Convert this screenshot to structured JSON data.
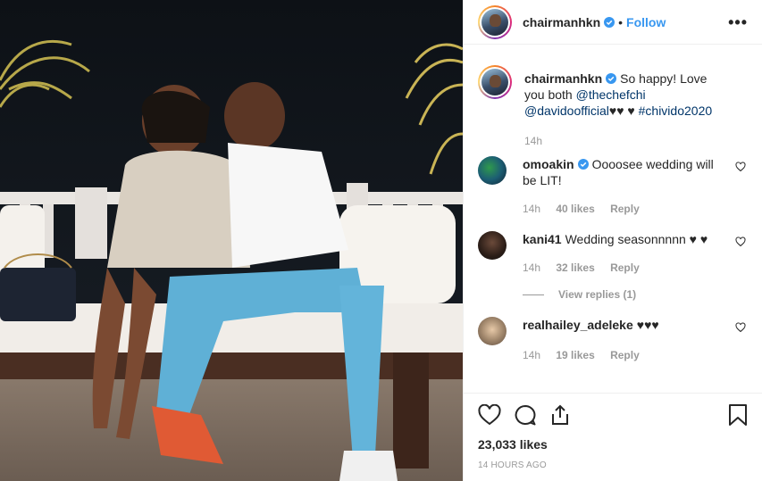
{
  "post": {
    "author": "chairmanhkn",
    "follow_label": "Follow",
    "separator": "•",
    "more_label": "•••"
  },
  "caption": {
    "author": "chairmanhkn",
    "text_part1": "So happy! Love you both",
    "mention1": "@thechefchi",
    "mention2": "@davidoofficial",
    "hearts1": "♥♥",
    "hearts2": "♥",
    "hashtag": "#chivido2020",
    "time": "14h"
  },
  "comments": [
    {
      "author": "omoakin",
      "verified": true,
      "text": "Oooosee wedding will be LIT!",
      "time": "14h",
      "likes": "40 likes",
      "reply": "Reply"
    },
    {
      "author": "kani41",
      "verified": false,
      "text": "Wedding seasonnnnn ♥ ♥",
      "time": "14h",
      "likes": "32 likes",
      "reply": "Reply",
      "view_replies": "View replies (1)"
    },
    {
      "author": "realhailey_adeleke",
      "verified": false,
      "text": "♥♥♥",
      "time": "14h",
      "likes": "19 likes",
      "reply": "Reply"
    }
  ],
  "likes_count": "23,033 likes",
  "posted_ago": "14 HOURS AGO",
  "colors": {
    "link_blue": "#3897f0",
    "mention_navy": "#003569",
    "muted": "#999999",
    "verified": "#3897f0"
  }
}
